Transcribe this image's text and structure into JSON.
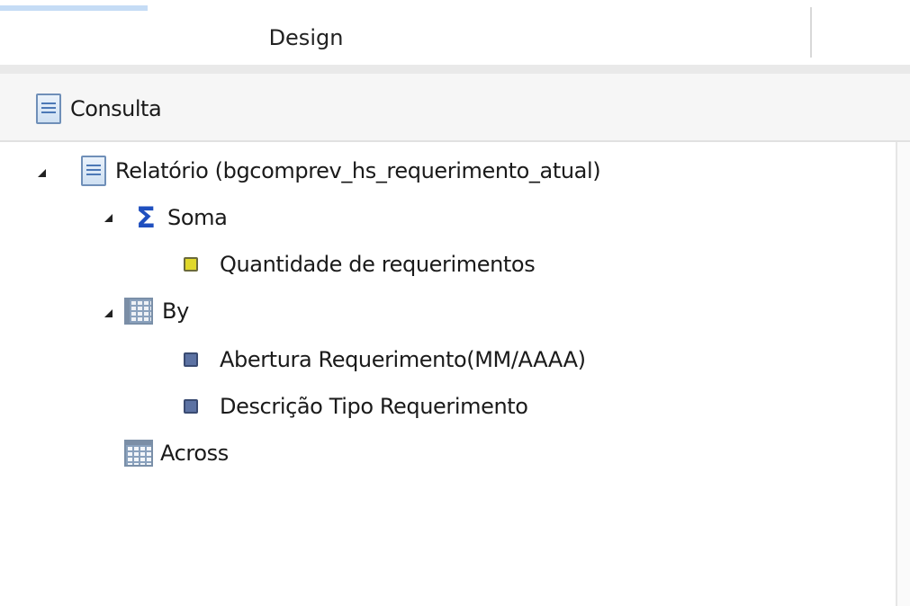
{
  "tabs": {
    "design_label": "Design"
  },
  "header": {
    "label": "Consulta",
    "icon": "document-icon"
  },
  "tree": {
    "report": {
      "label": "Relatório (bgcomprev_hs_requerimento_atual)",
      "icon": "document-icon",
      "expanded": true
    },
    "sum": {
      "label": "Soma",
      "icon": "sigma-icon",
      "expanded": true,
      "fields": [
        {
          "label": "Quantidade de requerimentos",
          "icon": "measure-field-icon"
        }
      ]
    },
    "by": {
      "label": "By",
      "icon": "grid-icon",
      "expanded": true,
      "fields": [
        {
          "label": "Abertura Requerimento(MM/AAAA)",
          "icon": "dimension-field-icon"
        },
        {
          "label": "Descrição Tipo Requerimento",
          "icon": "dimension-field-icon"
        }
      ]
    },
    "across": {
      "label": "Across",
      "icon": "grid-icon"
    }
  },
  "colors": {
    "sigma": "#1f4fbf",
    "measure_field": "#e0d82a",
    "dimension_field": "#5c72a3",
    "tab_accent": "#c5dcf5"
  }
}
